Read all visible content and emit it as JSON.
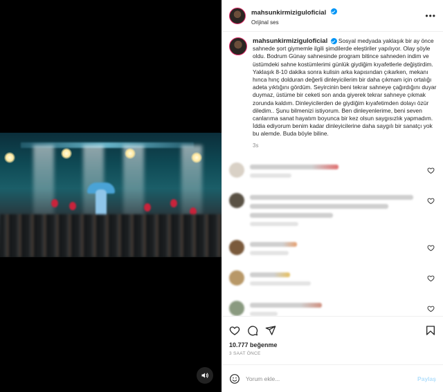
{
  "post": {
    "username": "mahsunkirmiziguloficial",
    "audio_label": "Orijinal ses",
    "caption": "Sosyal medyada yaklaşık bir ay önce sahnede şort giymemle ilgili şimdilerde eleştiriler yapılıyor. Olay şöyle oldu. Bodrum Günay sahnesinde program bitince sahneden indim ve üstümdeki sahne kostümlerimi günlük giydiğim kıyafetlerle değiştirdim. Yaklaşık 8-10 dakika sonra kulisin arka kapısından çıkarken, mekanı hınca hınç dolduran değerli dinleyicilerim bir daha çıkmam için ortalığı adeta yıktığını gördüm. Seyircinin beni tekrar sahneye çağırdığını duyar duymaz, üstüme bir ceketi son anda giyerek tekrar sahneye çıkmak zorunda kaldım. Dinleyicilerden de giydiğim kıyafetimden dolayı özür diledim.. Şunu bilmenizi istiyorum. Ben dinleyenlerime, beni seven canlarıma sanat hayatım boyunca bir kez olsun saygısızlık yapmadım. İddia ediyorum benim kadar dinleyicilerine daha saygılı bir sanatçı yok bu alemde. Buda böyle biline.",
    "caption_age": "3s",
    "likes": "10.777 beğenme",
    "posted_ago": "3 SAAT ÖNCE"
  },
  "comment_box": {
    "placeholder": "Yorum ekle...",
    "post_label": "Paylaş"
  },
  "colors": {
    "verified": "#0095f6",
    "post_button_disabled": "#b2dffc",
    "story_ring": "#e1306c"
  },
  "icons": {
    "more": "more-options-icon",
    "like": "heart-icon",
    "comment": "comment-icon",
    "share": "share-icon",
    "save": "bookmark-icon",
    "emoji": "emoji-icon",
    "audio": "speaker-icon"
  }
}
